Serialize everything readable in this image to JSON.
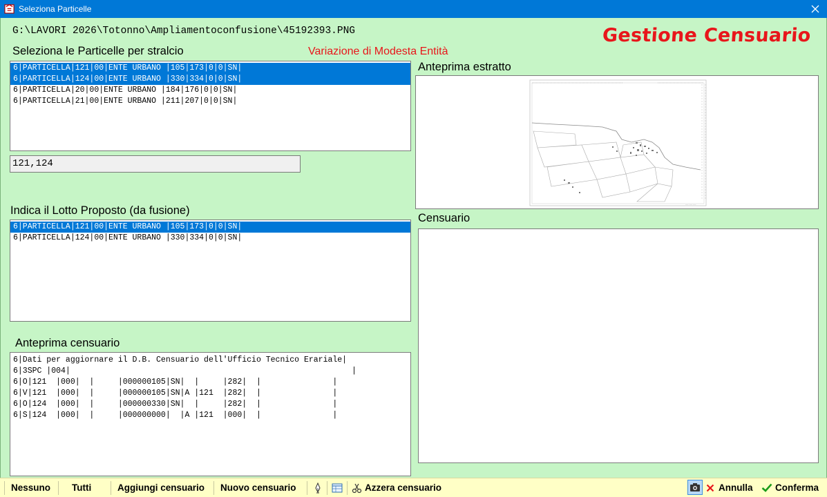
{
  "window": {
    "title": "Seleziona Particelle",
    "close_icon": "close-icon",
    "app_icon": "app-icon"
  },
  "header": {
    "path": "G:\\LAVORI 2026\\Totonno\\Ampliamentoconfusione\\45192393.PNG",
    "brand": "Gestione Censuario"
  },
  "selection": {
    "label": "Seleziona le Particelle per stralcio",
    "variation_label": "Variazione di Modesta Entità",
    "items": [
      {
        "text": "6|PARTICELLA|121|00|ENTE URBANO |105|173|0|0|SN|",
        "selected": true
      },
      {
        "text": "6|PARTICELLA|124|00|ENTE URBANO |330|334|0|0|SN|",
        "selected": true
      },
      {
        "text": "6|PARTICELLA|20|00|ENTE URBANO |184|176|0|0|SN|",
        "selected": false
      },
      {
        "text": "6|PARTICELLA|21|00|ENTE URBANO |211|207|0|0|SN|",
        "selected": false
      }
    ],
    "selected_value": "121,124"
  },
  "lotto": {
    "label": "Indica il Lotto Proposto (da fusione)",
    "items": [
      {
        "text": "6|PARTICELLA|121|00|ENTE URBANO |105|173|0|0|SN|",
        "selected": true
      },
      {
        "text": "6|PARTICELLA|124|00|ENTE URBANO |330|334|0|0|SN|",
        "selected": false
      }
    ]
  },
  "anteprima_censuario": {
    "label": "Anteprima censuario",
    "lines": [
      "6|Dati per aggiornare il D.B. Censuario dell'Ufficio Tecnico Erariale|",
      "6|3SPC |004|                                                           |",
      "6|O|121  |000|  |     |000000105|SN|  |     |282|  |               |",
      "6|V|121  |000|  |     |000000105|SN|A |121  |282|  |               |",
      "6|O|124  |000|  |     |000000330|SN|  |     |282|  |               |",
      "6|S|124  |000|  |     |000000000|  |A |121  |000|  |               |"
    ]
  },
  "estratto": {
    "label": "Anteprima estratto"
  },
  "censuario": {
    "label": "Censuario"
  },
  "toolbar": {
    "nessuno": "Nessuno",
    "tutti": "Tutti",
    "aggiungi": "Aggiungi censuario",
    "nuovo": "Nuovo censuario",
    "azzera": "Azzera censuario",
    "annulla": "Annulla",
    "conferma": "Conferma",
    "colors": {
      "annulla_icon": "#e8161b",
      "conferma_icon": "#1a9c1a"
    }
  },
  "colors": {
    "background": "#c6f5c6",
    "brand": "#e8161b",
    "selection": "#0078d7",
    "titlebar": "#0078d7",
    "toolbar": "#ffffc6"
  }
}
